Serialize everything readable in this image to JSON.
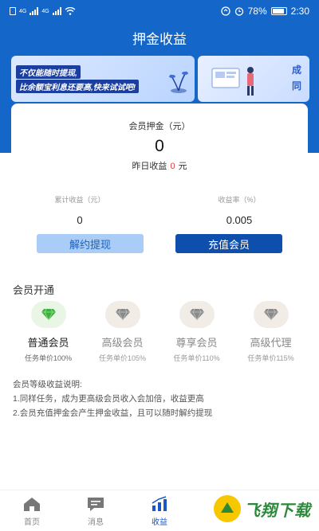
{
  "status_bar": {
    "network_1": "4G",
    "network_2": "4G",
    "battery": "78%",
    "time": "2:30"
  },
  "page_title": "押金收益",
  "banner": {
    "line1": "不仅能随时提现,",
    "line2": "比余额宝利息还要高,快来试试吧!",
    "side_text": "成同"
  },
  "deposit_card": {
    "label": "会员押金（元）",
    "value": "0",
    "yesterday_label": "昨日收益",
    "yesterday_value": "0",
    "yesterday_unit": "元"
  },
  "stats": {
    "cumulative_label": "累计收益（元）",
    "cumulative_value": "0",
    "rate_label": "收益率（%）",
    "rate_value": "0.005"
  },
  "buttons": {
    "withdraw": "解约提现",
    "recharge": "充值会员"
  },
  "section_title": "会员开通",
  "levels": [
    {
      "name": "普通会员",
      "price": "任务单价100%",
      "active": true
    },
    {
      "name": "高级会员",
      "price": "任务单价105%",
      "active": false
    },
    {
      "name": "尊享会员",
      "price": "任务单价110%",
      "active": false
    },
    {
      "name": "高级代理",
      "price": "任务单价115%",
      "active": false
    }
  ],
  "notes": {
    "title": "会员等级收益说明:",
    "line1": "1.同样任务，成为更高级会员收入会加倍，收益更高",
    "line2": "2.会员充值押金会产生押金收益，且可以随时解约提现"
  },
  "tabbar": [
    {
      "label": "首页",
      "icon": "home-icon",
      "active": false
    },
    {
      "label": "消息",
      "icon": "message-icon",
      "active": false
    },
    {
      "label": "收益",
      "icon": "chart-icon",
      "active": true
    }
  ],
  "watermark": {
    "text": "飞翔下载"
  },
  "colors": {
    "primary": "#1466c9",
    "accent_red": "#e53935",
    "button_light": "#a9cdf6",
    "button_dark": "#0e4fae",
    "diamond_active": "#3cb043",
    "diamond_inactive": "#8a8a8a"
  }
}
